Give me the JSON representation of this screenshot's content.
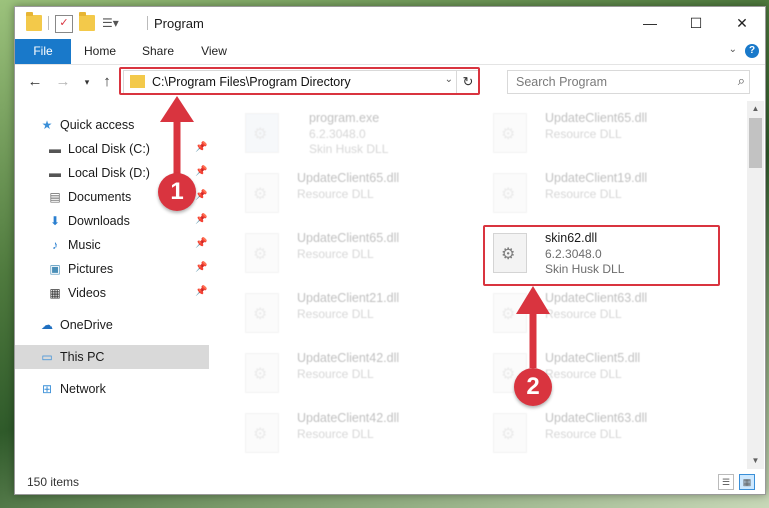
{
  "window": {
    "title": "Program"
  },
  "window_controls": {
    "minimize": "—",
    "maximize": "☐",
    "close": "✕"
  },
  "ribbon": {
    "tabs": [
      "File",
      "Home",
      "Share",
      "View"
    ],
    "help": "?"
  },
  "navigation": {
    "address_path": "C:\\Program Files\\Program Directory",
    "search_placeholder": "Search Program"
  },
  "sidebar": {
    "items": [
      {
        "label": "Quick access",
        "icon": "star-icon",
        "pinned": false
      },
      {
        "label": "Local Disk (C:)",
        "icon": "drive-icon",
        "pinned": true
      },
      {
        "label": "Local Disk (D:)",
        "icon": "drive-icon",
        "pinned": true
      },
      {
        "label": "Documents",
        "icon": "documents-icon",
        "pinned": true
      },
      {
        "label": "Downloads",
        "icon": "download-icon",
        "pinned": true
      },
      {
        "label": "Music",
        "icon": "music-icon",
        "pinned": true
      },
      {
        "label": "Pictures",
        "icon": "pictures-icon",
        "pinned": true
      },
      {
        "label": "Videos",
        "icon": "videos-icon",
        "pinned": true
      },
      {
        "label": "OneDrive",
        "icon": "cloud-icon",
        "pinned": false
      },
      {
        "label": "This PC",
        "icon": "computer-icon",
        "pinned": false,
        "selected": true
      },
      {
        "label": "Network",
        "icon": "network-icon",
        "pinned": false
      }
    ]
  },
  "files": {
    "left_column": [
      {
        "name": "program.exe",
        "version": "6.2.3048.0",
        "description": "Skin Husk DLL"
      },
      {
        "name": "UpdateClient65.dll",
        "description": "Resource DLL"
      },
      {
        "name": "UpdateClient65.dll",
        "description": "Resource DLL"
      },
      {
        "name": "UpdateClient21.dll",
        "description": "Resource DLL"
      },
      {
        "name": "UpdateClient42.dll",
        "description": "Resource DLL"
      },
      {
        "name": "UpdateClient42.dll",
        "description": "Resource DLL"
      }
    ],
    "right_column": [
      {
        "name": "UpdateClient65.dll",
        "description": "Resource DLL"
      },
      {
        "name": "UpdateClient19.dll",
        "description": "Resource DLL"
      },
      {
        "name": "skin62.dll",
        "version": "6.2.3048.0",
        "description": "Skin Husk DLL",
        "highlighted": true
      },
      {
        "name": "UpdateClient63.dll",
        "description": "Resource DLL"
      },
      {
        "name": "UpdateClient5.dll",
        "description": "Resource DLL"
      },
      {
        "name": "UpdateClient63.dll",
        "description": "Resource DLL"
      }
    ]
  },
  "status": {
    "item_count": "150 items"
  },
  "annotations": {
    "badge_1": "1",
    "badge_2": "2",
    "color": "#d9343f"
  },
  "colors": {
    "accent": "#1979ca",
    "highlight_box": "#d9343f"
  }
}
